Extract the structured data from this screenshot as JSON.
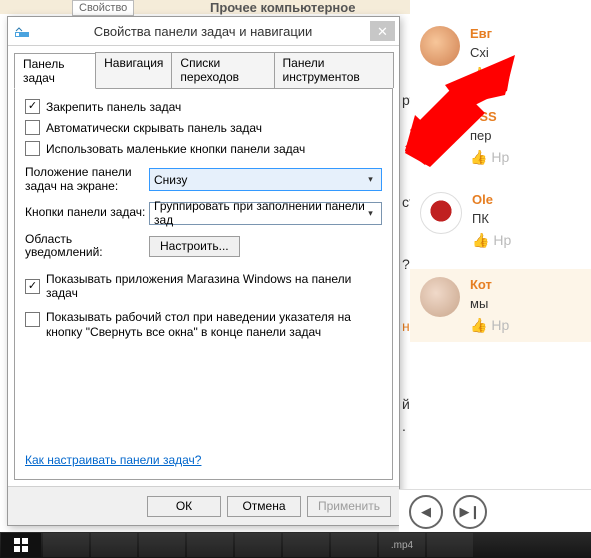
{
  "background": {
    "tab_label": "Свойство",
    "heading": "Прочее компьютерное",
    "frags": [
      "рта",
      "ста,",
      "???",
      "нен,",
      "й на",
      "."
    ]
  },
  "dialog": {
    "title": "Свойства панели задач и навигации",
    "tabs": [
      "Панель задач",
      "Навигация",
      "Списки переходов",
      "Панели инструментов"
    ],
    "chk_lock": "Закрепить панель задач",
    "chk_autohide": "Автоматически скрывать панель задач",
    "chk_small": "Использовать маленькие кнопки панели задач",
    "pos_label": "Положение панели задач на экране:",
    "pos_value": "Снизу",
    "btns_label": "Кнопки панели задач:",
    "btns_value": "Группировать при заполнении панели зад",
    "notif_label": "Область уведомлений:",
    "notif_btn": "Настроить...",
    "chk_store": "Показывать приложения Магазина Windows на панели задач",
    "chk_peek": "Показывать рабочий стол при наведении указателя на кнопку \"Свернуть все окна\" в конце панели задач",
    "help_link": "Как настраивать панели задач?",
    "ok": "ОК",
    "cancel": "Отмена",
    "apply": "Применить"
  },
  "comments": [
    {
      "name": "Евг",
      "text": "Схі",
      "like": "Нр"
    },
    {
      "name": "USS",
      "text": "пер",
      "like": "Нр"
    },
    {
      "name": "Ole",
      "text": "ПК",
      "like": "Нр"
    },
    {
      "name": "Кот",
      "text": "мы",
      "like": "Нр"
    }
  ],
  "taskbar": {
    "file_ext": ".mp4"
  }
}
